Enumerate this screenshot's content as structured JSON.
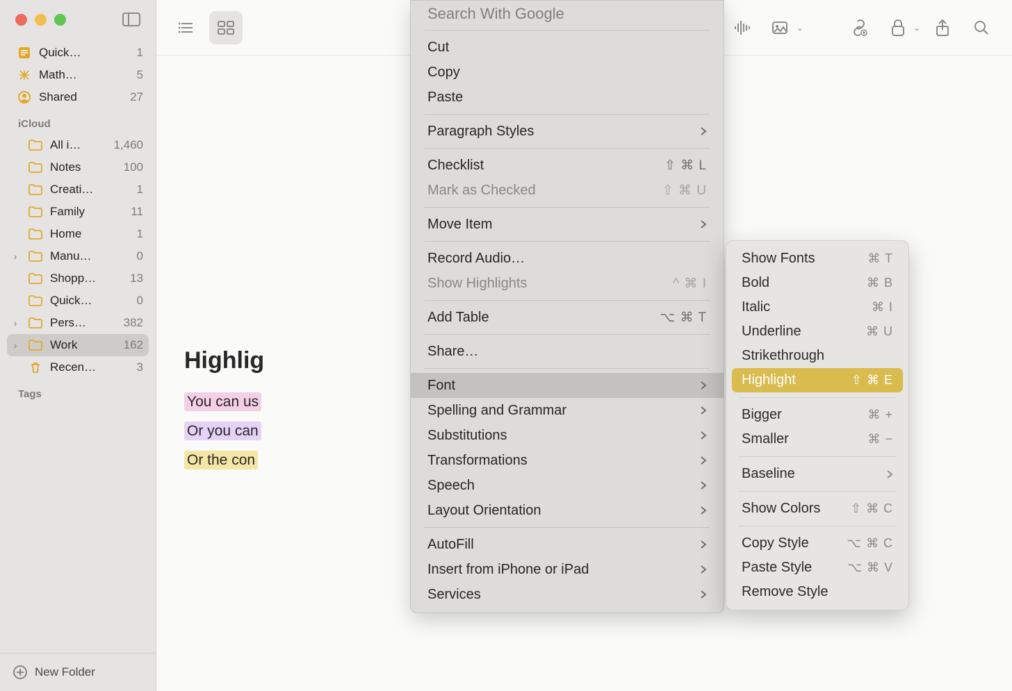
{
  "sidebar": {
    "top_items": [
      {
        "label": "Quick…",
        "count": "1",
        "icon": "quick"
      },
      {
        "label": "Math…",
        "count": "5",
        "icon": "math"
      },
      {
        "label": "Shared",
        "count": "27",
        "icon": "shared"
      }
    ],
    "section_label": "iCloud",
    "folders": [
      {
        "label": "All i…",
        "count": "1,460",
        "disclosure": ""
      },
      {
        "label": "Notes",
        "count": "100",
        "disclosure": ""
      },
      {
        "label": "Creati…",
        "count": "1",
        "disclosure": ""
      },
      {
        "label": "Family",
        "count": "11",
        "disclosure": ""
      },
      {
        "label": "Home",
        "count": "1",
        "disclosure": ""
      },
      {
        "label": "Manu…",
        "count": "0",
        "disclosure": ">"
      },
      {
        "label": "Shopp…",
        "count": "13",
        "disclosure": ""
      },
      {
        "label": "Quick…",
        "count": "0",
        "disclosure": ""
      },
      {
        "label": "Pers…",
        "count": "382",
        "disclosure": ">"
      },
      {
        "label": "Work",
        "count": "162",
        "disclosure": ">",
        "selected": true
      },
      {
        "label": "Recen…",
        "count": "3",
        "disclosure": "",
        "icon": "trash"
      }
    ],
    "tags_label": "Tags",
    "new_folder": "New Folder"
  },
  "note": {
    "title": "Highlig",
    "line1": "You can us",
    "line2": "Or you can",
    "line3": "Or the con"
  },
  "context_menu": {
    "search_google": "Search With Google",
    "cut": "Cut",
    "copy": "Copy",
    "paste": "Paste",
    "paragraph_styles": "Paragraph Styles",
    "checklist": "Checklist",
    "checklist_key": "⇧ ⌘ L",
    "mark_as_checked": "Mark as Checked",
    "mark_as_checked_key": "⇧ ⌘ U",
    "move_item": "Move Item",
    "record_audio": "Record Audio…",
    "show_highlights": "Show Highlights",
    "show_highlights_key": "^ ⌘ I",
    "add_table": "Add Table",
    "add_table_key": "⌥ ⌘ T",
    "share": "Share…",
    "font": "Font",
    "spelling": "Spelling and Grammar",
    "substitutions": "Substitutions",
    "transformations": "Transformations",
    "speech": "Speech",
    "layout": "Layout Orientation",
    "autofill": "AutoFill",
    "insert_iphone": "Insert from iPhone or iPad",
    "services": "Services"
  },
  "font_submenu": {
    "show_fonts": "Show Fonts",
    "show_fonts_key": "⌘ T",
    "bold": "Bold",
    "bold_key": "⌘ B",
    "italic": "Italic",
    "italic_key": "⌘ I",
    "underline": "Underline",
    "underline_key": "⌘ U",
    "strikethrough": "Strikethrough",
    "highlight": "Highlight",
    "highlight_key": "⇧ ⌘ E",
    "bigger": "Bigger",
    "bigger_key": "⌘ +",
    "smaller": "Smaller",
    "smaller_key": "⌘ −",
    "baseline": "Baseline",
    "show_colors": "Show Colors",
    "show_colors_key": "⇧ ⌘ C",
    "copy_style": "Copy Style",
    "copy_style_key": "⌥ ⌘ C",
    "paste_style": "Paste Style",
    "paste_style_key": "⌥ ⌘ V",
    "remove_style": "Remove Style"
  }
}
